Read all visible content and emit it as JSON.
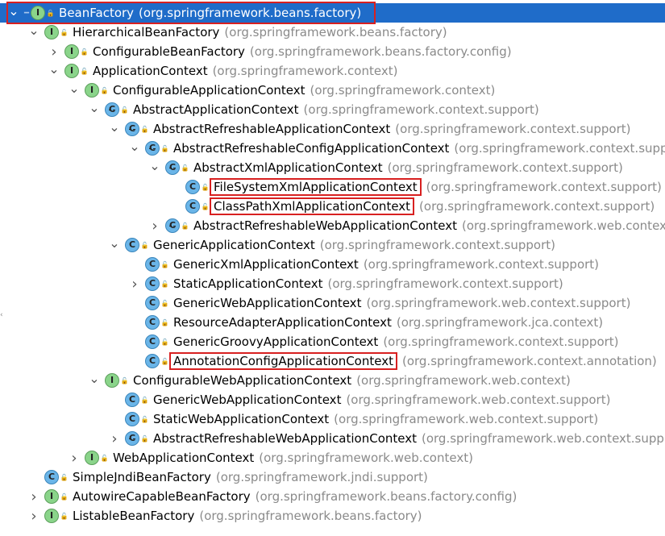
{
  "tree": [
    {
      "name": "BeanFactory",
      "pkg": "(org.springframework.beans.factory)",
      "type": "iface",
      "arrow": "down",
      "selected": true
    },
    {
      "name": "HierarchicalBeanFactory",
      "pkg": "(org.springframework.beans.factory)",
      "type": "iface",
      "arrow": "down"
    },
    {
      "name": "ConfigurableBeanFactory",
      "pkg": "(org.springframework.beans.factory.config)",
      "type": "iface",
      "arrow": "right"
    },
    {
      "name": "ApplicationContext",
      "pkg": "(org.springframework.context)",
      "type": "iface",
      "arrow": "down"
    },
    {
      "name": "ConfigurableApplicationContext",
      "pkg": "(org.springframework.context)",
      "type": "iface",
      "arrow": "down"
    },
    {
      "name": "AbstractApplicationContext",
      "pkg": "(org.springframework.context.support)",
      "type": "abstract",
      "arrow": "down"
    },
    {
      "name": "AbstractRefreshableApplicationContext",
      "pkg": "(org.springframework.context.support)",
      "type": "abstract",
      "arrow": "down"
    },
    {
      "name": "AbstractRefreshableConfigApplicationContext",
      "pkg": "(org.springframework.context.supp",
      "type": "abstract",
      "arrow": "down"
    },
    {
      "name": "AbstractXmlApplicationContext",
      "pkg": "(org.springframework.context.support)",
      "type": "abstract",
      "arrow": "down"
    },
    {
      "name": "FileSystemXmlApplicationContext",
      "pkg": "(org.springframework.context.support)",
      "type": "class",
      "arrow": "none",
      "highlight": true
    },
    {
      "name": "ClassPathXmlApplicationContext",
      "pkg": "(org.springframework.context.support)",
      "type": "class",
      "arrow": "none",
      "highlight": true
    },
    {
      "name": "AbstractRefreshableWebApplicationContext",
      "pkg": "(org.springframework.web.contex",
      "type": "abstract",
      "arrow": "right"
    },
    {
      "name": "GenericApplicationContext",
      "pkg": "(org.springframework.context.support)",
      "type": "class",
      "arrow": "down"
    },
    {
      "name": "GenericXmlApplicationContext",
      "pkg": "(org.springframework.context.support)",
      "type": "class",
      "arrow": "none"
    },
    {
      "name": "StaticApplicationContext",
      "pkg": "(org.springframework.context.support)",
      "type": "class",
      "arrow": "right"
    },
    {
      "name": "GenericWebApplicationContext",
      "pkg": "(org.springframework.web.context.support)",
      "type": "class",
      "arrow": "none"
    },
    {
      "name": "ResourceAdapterApplicationContext",
      "pkg": "(org.springframework.jca.context)",
      "type": "class",
      "arrow": "none"
    },
    {
      "name": "GenericGroovyApplicationContext",
      "pkg": "(org.springframework.context.support)",
      "type": "class",
      "arrow": "none"
    },
    {
      "name": "AnnotationConfigApplicationContext",
      "pkg": "(org.springframework.context.annotation)",
      "type": "class",
      "arrow": "none",
      "highlight": true
    },
    {
      "name": "ConfigurableWebApplicationContext",
      "pkg": "(org.springframework.web.context)",
      "type": "iface",
      "arrow": "down"
    },
    {
      "name": "GenericWebApplicationContext",
      "pkg": "(org.springframework.web.context.support)",
      "type": "class",
      "arrow": "none"
    },
    {
      "name": "StaticWebApplicationContext",
      "pkg": "(org.springframework.web.context.support)",
      "type": "class",
      "arrow": "none"
    },
    {
      "name": "AbstractRefreshableWebApplicationContext",
      "pkg": "(org.springframework.web.context.supp",
      "type": "abstract",
      "arrow": "right"
    },
    {
      "name": "WebApplicationContext",
      "pkg": "(org.springframework.web.context)",
      "type": "iface",
      "arrow": "right"
    },
    {
      "name": "SimpleJndiBeanFactory",
      "pkg": "(org.springframework.jndi.support)",
      "type": "class",
      "arrow": "none"
    },
    {
      "name": "AutowireCapableBeanFactory",
      "pkg": "(org.springframework.beans.factory.config)",
      "type": "iface",
      "arrow": "right"
    },
    {
      "name": "ListableBeanFactory",
      "pkg": "(org.springframework.beans.factory)",
      "type": "iface",
      "arrow": "right"
    }
  ],
  "icon_letters": {
    "iface": "I",
    "class": "C",
    "abstract": "C"
  },
  "colors": {
    "selection": "#1f6cc9",
    "highlight_border": "#d82020",
    "package_text": "#8a8a8a"
  }
}
